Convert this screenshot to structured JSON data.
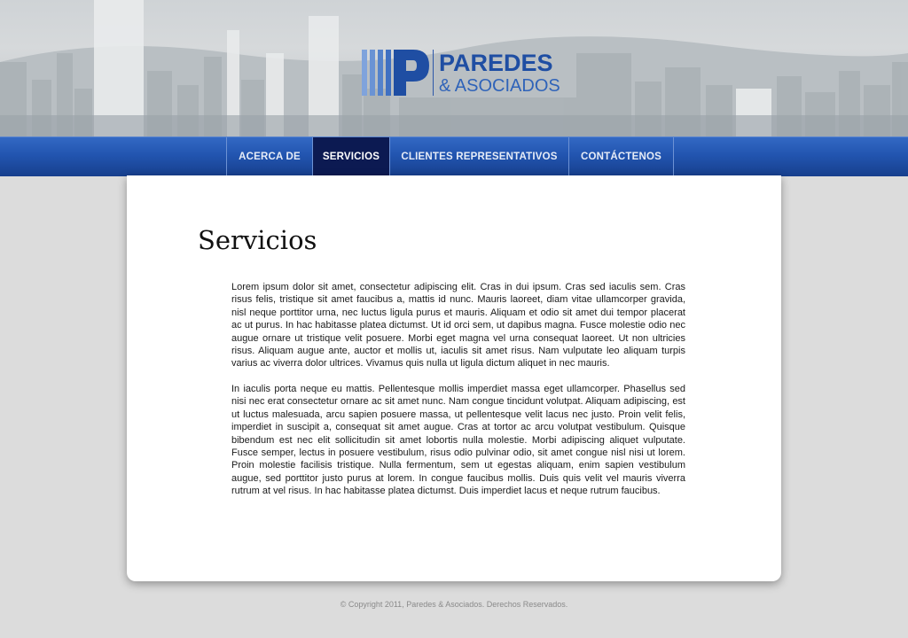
{
  "brand": {
    "name": "PAREDES",
    "subtitle": "& ASOCIADOS",
    "color": "#1f4ea3"
  },
  "nav": {
    "items": [
      {
        "label": "ACERCA DE",
        "active": false
      },
      {
        "label": "SERVICIOS",
        "active": true
      },
      {
        "label": "CLIENTES REPRESENTATIVOS",
        "active": false
      },
      {
        "label": "CONTÁCTENOS",
        "active": false
      }
    ]
  },
  "main": {
    "title": "Servicios",
    "paragraphs": [
      "Lorem ipsum dolor sit amet, consectetur adipiscing elit. Cras in dui ipsum. Cras sed iaculis sem. Cras risus felis, tristique sit amet faucibus a, mattis id nunc. Mauris laoreet, diam vitae ullamcorper gravida, nisl neque porttitor urna, nec luctus ligula purus et mauris. Aliquam et odio sit amet dui tempor placerat ac ut purus. In hac habitasse platea dictumst. Ut id orci sem, ut dapibus magna. Fusce molestie odio nec augue ornare ut tristique velit posuere. Morbi eget magna vel urna consequat laoreet. Ut non ultricies risus. Aliquam augue ante, auctor et mollis ut, iaculis sit amet risus. Nam vulputate leo aliquam turpis varius ac viverra dolor ultrices. Vivamus quis nulla ut ligula dictum aliquet in nec mauris.",
      "In iaculis porta neque eu mattis. Pellentesque mollis imperdiet massa eget ullamcorper. Phasellus sed nisi nec erat consectetur ornare ac sit amet nunc. Nam congue tincidunt volutpat. Aliquam adipiscing, est ut luctus malesuada, arcu sapien posuere massa, ut pellentesque velit lacus nec justo. Proin velit felis, imperdiet in suscipit a, consequat sit amet augue. Cras at tortor ac arcu volutpat vestibulum. Quisque bibendum est nec elit sollicitudin sit amet lobortis nulla molestie. Morbi adipiscing aliquet vulputate. Fusce semper, lectus in posuere vestibulum, risus odio pulvinar odio, sit amet congue nisl nisi ut lorem. Proin molestie facilisis tristique. Nulla fermentum, sem ut egestas aliquam, enim sapien vestibulum augue, sed porttitor justo purus at lorem. In congue faucibus mollis. Duis quis velit vel mauris viverra rutrum at vel risus. In hac habitasse platea dictumst. Duis imperdiet lacus et neque rutrum faucibus."
    ]
  },
  "footer": {
    "copyright": "© Copyright 2011, Paredes & Asociados. Derechos Reservados."
  },
  "colors": {
    "nav_bar": "#2255b0",
    "nav_active": "#0c1a52",
    "page_background": "#dcdcdc"
  }
}
